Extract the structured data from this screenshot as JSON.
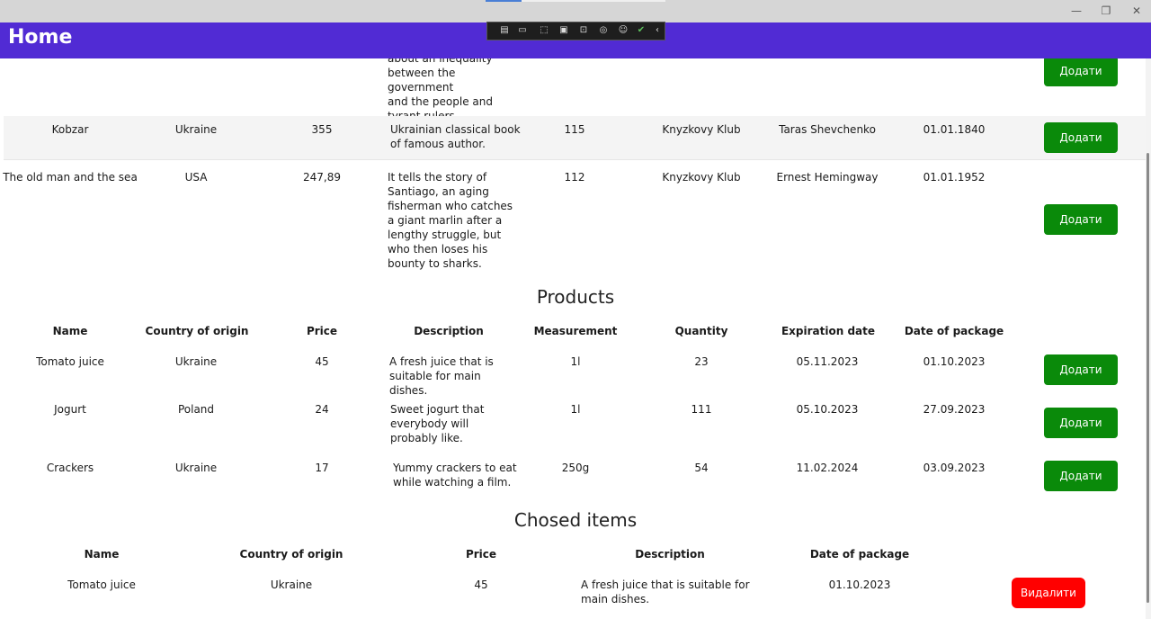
{
  "window": {
    "minimize": "—",
    "restore": "❐",
    "close": "✕"
  },
  "header": {
    "title": "Home"
  },
  "devtools": {
    "icons": [
      "live-tree-icon",
      "record-icon",
      "select-element-icon",
      "display-layout-icon",
      "track-focus-icon",
      "binding-failures-icon",
      "accessibility-icon",
      "check-icon",
      "collapse-icon"
    ]
  },
  "books": {
    "partial_description": [
      "about an inequality",
      "between the government",
      "and the people and",
      "tyrant rulers."
    ],
    "rows": [
      {
        "name": "Kobzar",
        "country": "Ukraine",
        "price": "355",
        "description": "Ukrainian classical book of famous author.",
        "pages": "115",
        "publisher": "Knyzkovy Klub",
        "author": "Taras Shevchenko",
        "date": "01.01.1840"
      },
      {
        "name": "The old man and the sea",
        "country": "USA",
        "price": "247,89",
        "description": "It tells the story of Santiago, an aging fisherman who catches a giant marlin after a lengthy struggle, but who then loses his bounty to sharks.",
        "pages": "112",
        "publisher": "Knyzkovy Klub",
        "author": "Ernest Hemingway",
        "date": "01.01.1952"
      }
    ],
    "add_label": "Додати"
  },
  "products": {
    "title": "Products",
    "headers": [
      "Name",
      "Country of origin",
      "Price",
      "Description",
      "Measurement",
      "Quantity",
      "Expiration date",
      "Date of package"
    ],
    "rows": [
      {
        "name": "Tomato juice",
        "country": "Ukraine",
        "price": "45",
        "description": "A fresh juice that is suitable for main dishes.",
        "measurement": "1l",
        "quantity": "23",
        "expiration": "05.11.2023",
        "package": "01.10.2023"
      },
      {
        "name": "Jogurt",
        "country": "Poland",
        "price": "24",
        "description": "Sweet jogurt that everybody will probably like.",
        "measurement": "1l",
        "quantity": "111",
        "expiration": "05.10.2023",
        "package": "27.09.2023"
      },
      {
        "name": "Crackers",
        "country": "Ukraine",
        "price": "17",
        "description": "Yummy crackers to eat while watching a film.",
        "measurement": "250g",
        "quantity": "54",
        "expiration": "11.02.2024",
        "package": "03.09.2023"
      }
    ],
    "add_label": "Додати"
  },
  "chosen": {
    "title": "Chosed items",
    "headers": [
      "Name",
      "Country of origin",
      "Price",
      "Description",
      "Date of package"
    ],
    "rows": [
      {
        "name": "Tomato juice",
        "country": "Ukraine",
        "price": "45",
        "description": "A fresh juice that is suitable for main dishes.",
        "package": "01.10.2023"
      }
    ],
    "delete_label": "Видалити"
  },
  "colors": {
    "header": "#512bd4",
    "add": "#0a8a0a",
    "delete": "#ff0000"
  }
}
